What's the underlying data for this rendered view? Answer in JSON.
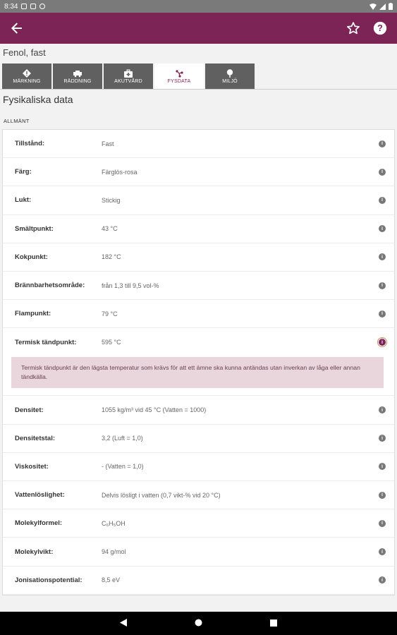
{
  "status_bar": {
    "time": "8:34"
  },
  "app_bar": {
    "icons": [
      "arrow-back-icon",
      "star-outline-icon",
      "help-circle-icon"
    ]
  },
  "subtitle": "Fenol, fast",
  "tabs": [
    {
      "label": "MÄRKNING",
      "icon": "warning-diamond-icon"
    },
    {
      "label": "RÄDDNING",
      "icon": "fire-truck-icon"
    },
    {
      "label": "AKUTVÅRD",
      "icon": "first-aid-kit-icon"
    },
    {
      "label": "FYSDATA",
      "icon": "molecule-icon"
    },
    {
      "label": "MILJÖ",
      "icon": "tree-icon"
    }
  ],
  "section_title": "Fysikaliska data",
  "section_sub": "ALLMÄNT",
  "rows": [
    {
      "label": "Tillstånd:",
      "value": "Fast"
    },
    {
      "label": "Färg:",
      "value": "Färglös-rosa"
    },
    {
      "label": "Lukt:",
      "value": "Stickig"
    },
    {
      "label": "Smältpunkt:",
      "value": "43 °C"
    },
    {
      "label": "Kokpunkt:",
      "value": "182 °C"
    },
    {
      "label": "Brännbarhetsområde:",
      "value": "från 1,3 till 9,5 vol-%"
    },
    {
      "label": "Flampunkt:",
      "value": "79 °C"
    },
    {
      "label": "Termisk tändpunkt:",
      "value": "595 °C"
    },
    {
      "label": "Densitet:",
      "value": "1055 kg/m³ vid 45 °C  (Vatten = 1000)"
    },
    {
      "label": "Densitetstal:",
      "value": "3,2  (Luft = 1,0)"
    },
    {
      "label": "Viskositet:",
      "value": "-  (Vatten = 1,0)"
    },
    {
      "label": "Vattenlöslighet:",
      "value": "Delvis lösligt i vatten (0,7 vikt-% vid 20 °C)"
    },
    {
      "label": "Molekylformel:",
      "value": "C₆H₅OH"
    },
    {
      "label": "Molekylvikt:",
      "value": "94 g/mol"
    },
    {
      "label": "Jonisationspotential:",
      "value": "8,5 eV"
    }
  ],
  "explanation": "Termisk tändpunkt är den lägsta temperatur som krävs för att ett ämne ska kunna antändas utan inverkan av låga eller annan tändkälla.",
  "colors": {
    "primary": "#7d2457",
    "tab_inactive": "#606060",
    "explanation_bg": "#e8d6dc"
  }
}
